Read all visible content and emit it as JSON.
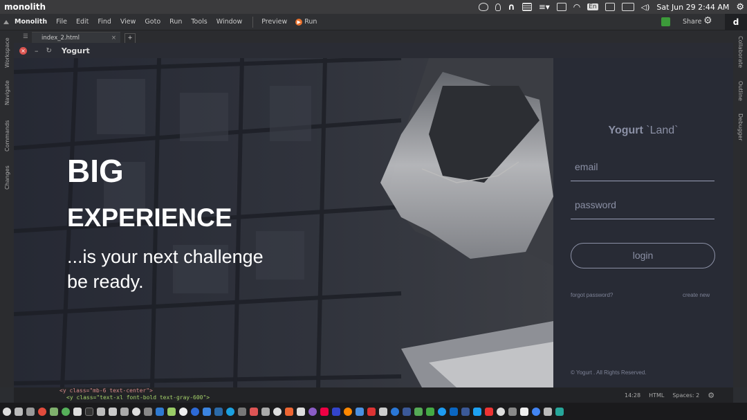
{
  "system_bar": {
    "app_name": "monolith",
    "keyboard_indicator": "En",
    "datetime": "Sat Jun 29  2:44 AM"
  },
  "menu": {
    "items": [
      "Monolith",
      "File",
      "Edit",
      "Find",
      "View",
      "Goto",
      "Run",
      "Tools",
      "Window"
    ],
    "preview": "Preview",
    "run": "Run",
    "share": "Share"
  },
  "left_rail": [
    "Workspace",
    "Navigate",
    "Commands",
    "Changes"
  ],
  "right_rail": [
    "Collaborate",
    "Outline",
    "Debugger"
  ],
  "tabs": [
    {
      "label": "index_2.html",
      "close": "×"
    }
  ],
  "tab_add": "+",
  "preview_window": {
    "title": "Yogurt"
  },
  "hero": {
    "line1": "BIG",
    "line2": "EXPERIENCE",
    "line3": "...is your next challenge",
    "line4": "be ready."
  },
  "login": {
    "brand": "Yogurt",
    "brand_suffix": "`Land`",
    "email_placeholder": "email",
    "password_placeholder": "password",
    "button": "login",
    "forgot": "forgot password?",
    "create": "create new",
    "footer": "© Yogurt . All Rights Reserved."
  },
  "code_lines": [
    "<y class=\"mb-6 text-center\">",
    "<y class=\"text-xl font-bold text-gray-600\">"
  ],
  "status": {
    "cursor": "14:28",
    "language": "HTML",
    "indent": "Spaces: 2"
  },
  "colors": {
    "accent_run": "#e8712d",
    "close_red": "#d9534f",
    "panel": "#282b35",
    "muted_text": "#8b90a5"
  }
}
